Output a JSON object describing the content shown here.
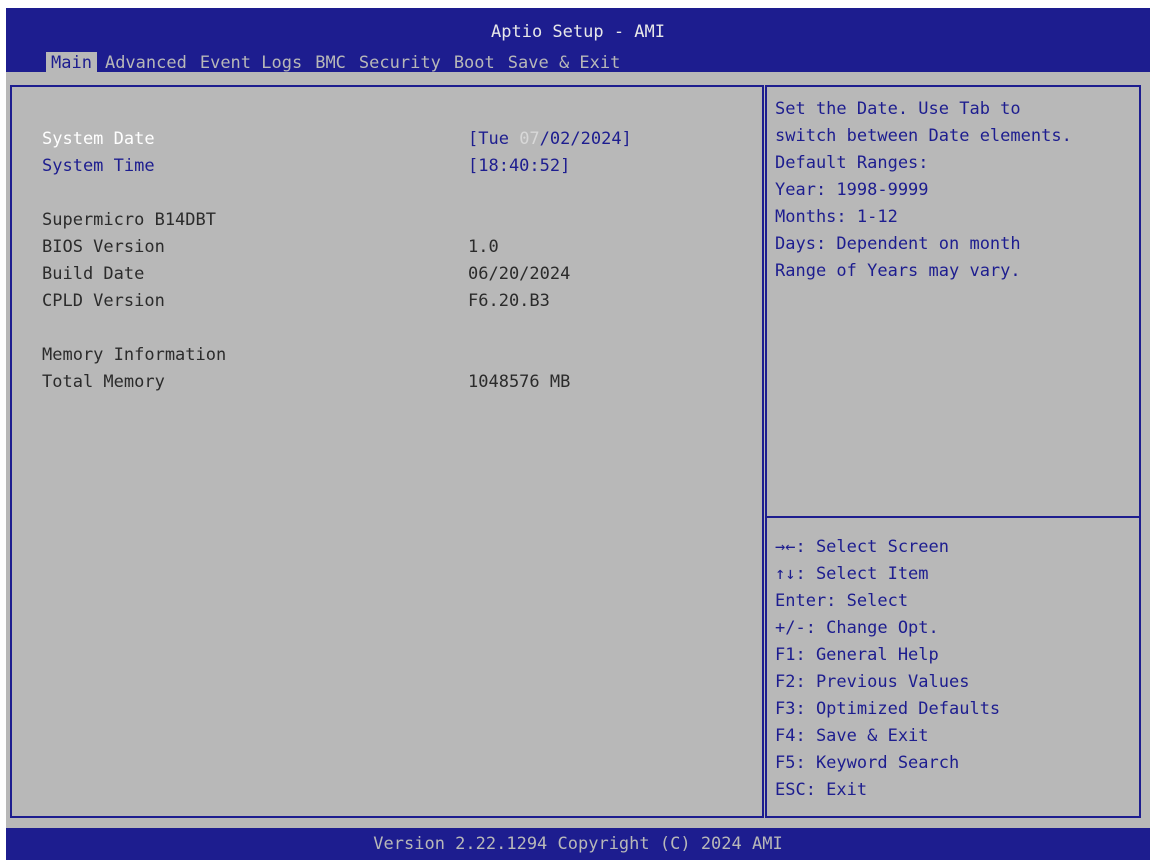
{
  "app_title": "Aptio Setup - AMI",
  "tabs": [
    {
      "label": "Main",
      "active": true
    },
    {
      "label": "Advanced",
      "active": false
    },
    {
      "label": "Event Logs",
      "active": false
    },
    {
      "label": "BMC",
      "active": false
    },
    {
      "label": "Security",
      "active": false
    },
    {
      "label": "Boot",
      "active": false
    },
    {
      "label": "Save & Exit",
      "active": false
    }
  ],
  "main": {
    "system_date": {
      "label": "System Date",
      "prefix": "[Tue ",
      "highlight": "07",
      "suffix": "/02/2024]"
    },
    "system_time": {
      "label": "System Time",
      "value": "[18:40:52]"
    },
    "board_name": "Supermicro B14DBT",
    "bios_version": {
      "label": "BIOS Version",
      "value": "1.0"
    },
    "build_date": {
      "label": "Build Date",
      "value": "06/20/2024"
    },
    "cpld_version": {
      "label": "CPLD Version",
      "value": "F6.20.B3"
    },
    "memory_info_heading": "Memory Information",
    "total_memory": {
      "label": "Total Memory",
      "value": "1048576 MB"
    }
  },
  "help": {
    "lines": [
      "Set the Date. Use Tab to",
      "switch between Date elements.",
      "Default Ranges:",
      "Year: 1998-9999",
      "Months: 1-12",
      "Days: Dependent on month",
      "Range of Years may vary."
    ]
  },
  "keys": [
    "→←: Select Screen",
    "↑↓: Select Item",
    "Enter: Select",
    "+/-: Change Opt.",
    "F1: General Help",
    "F2: Previous Values",
    "F3: Optimized Defaults",
    "F4: Save & Exit",
    "F5: Keyword Search",
    "ESC: Exit"
  ],
  "footer": "Version 2.22.1294 Copyright (C) 2024 AMI",
  "colors": {
    "bios_blue": "#1d1d8f",
    "panel_gray": "#b8b8b8",
    "selected_text": "#ffffff"
  }
}
